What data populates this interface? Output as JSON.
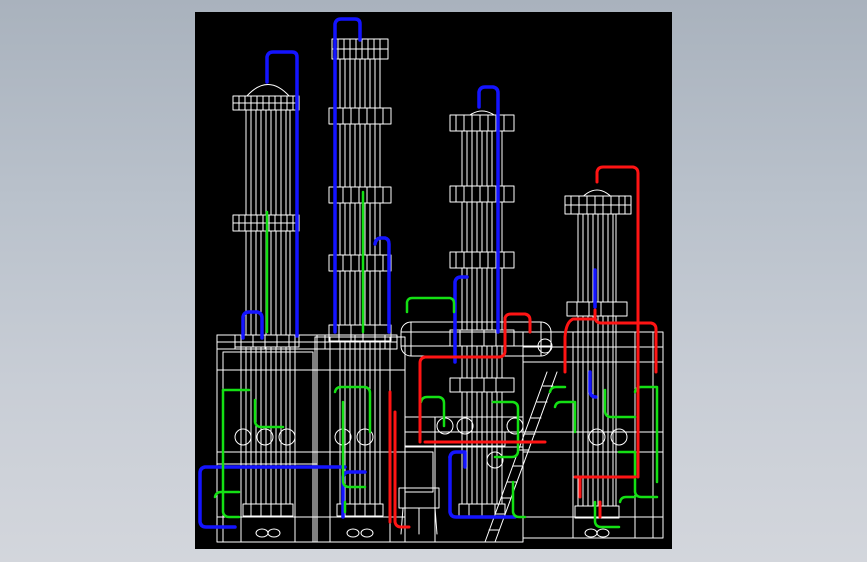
{
  "background": {
    "top_color": "#a9b2bd",
    "bottom_color": "#d3d6dc"
  },
  "viewport": {
    "background_color": "#000000",
    "wire_color": "#ffffff",
    "pipe_colors": {
      "blue": "#1414ff",
      "green": "#14e014",
      "red": "#ff1414"
    }
  },
  "model": {
    "columns": [
      "column-1",
      "column-2",
      "column-3",
      "column-4"
    ]
  }
}
